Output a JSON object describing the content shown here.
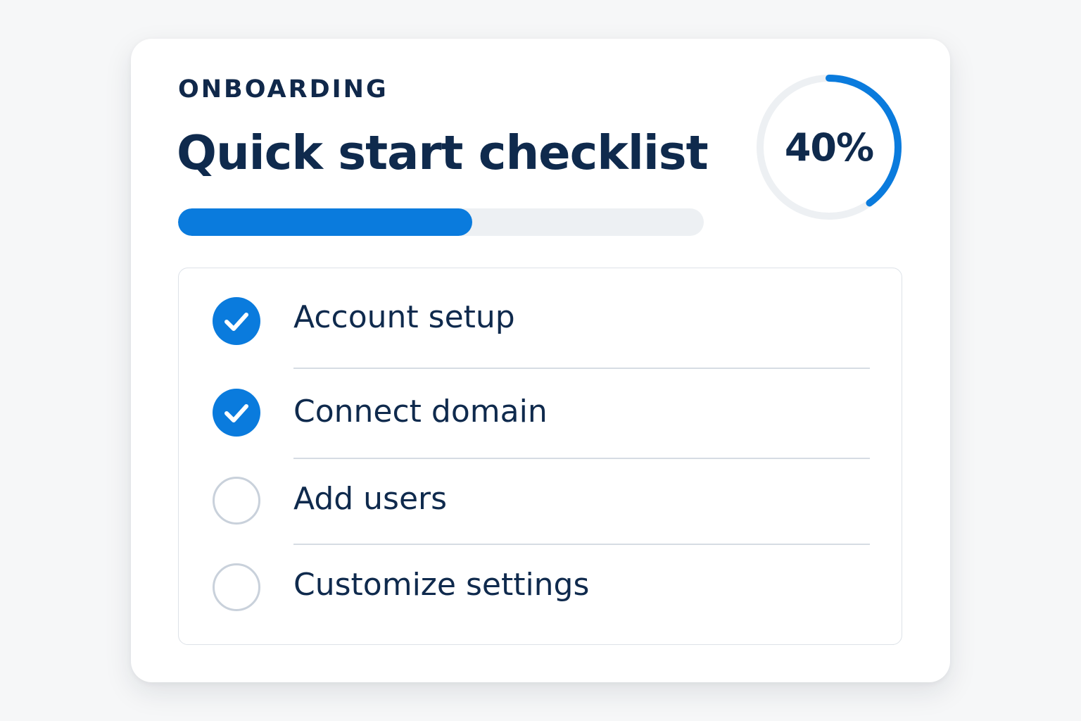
{
  "card": {
    "eyebrow": "ONBOARDING",
    "title": "Quick start checklist",
    "progress": {
      "percent": 40,
      "label": "40%",
      "bar_fill_fraction": 0.56
    },
    "colors": {
      "accent": "#0a7bdd",
      "text": "#0f2a4d",
      "track": "#edf0f3",
      "todo_border": "#c9d1db"
    }
  },
  "checklist": {
    "items": [
      {
        "label": "Account setup",
        "done": true,
        "icon": "check-circle-icon"
      },
      {
        "label": "Connect domain",
        "done": true,
        "icon": "check-circle-icon"
      },
      {
        "label": "Add users",
        "done": false,
        "icon": "empty-circle-icon"
      },
      {
        "label": "Customize settings",
        "done": false,
        "icon": "empty-circle-icon"
      }
    ]
  }
}
